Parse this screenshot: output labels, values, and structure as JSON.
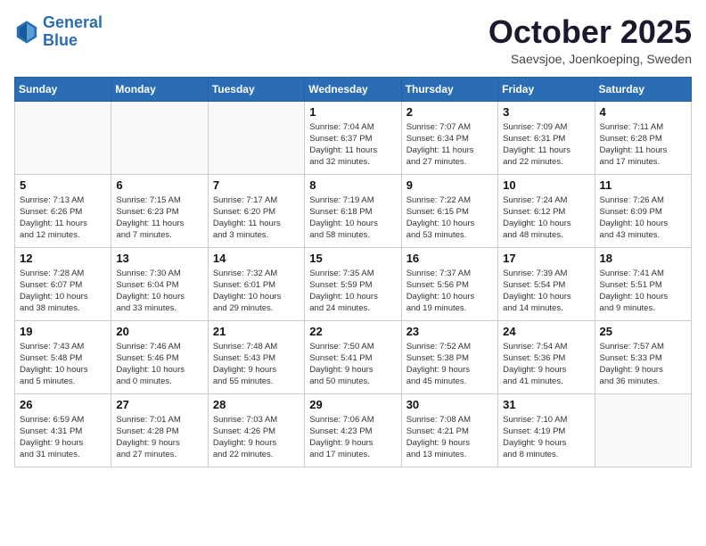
{
  "logo": {
    "line1": "General",
    "line2": "Blue"
  },
  "title": "October 2025",
  "location": "Saevsjoe, Joenkoeping, Sweden",
  "weekdays": [
    "Sunday",
    "Monday",
    "Tuesday",
    "Wednesday",
    "Thursday",
    "Friday",
    "Saturday"
  ],
  "weeks": [
    [
      {
        "day": "",
        "info": ""
      },
      {
        "day": "",
        "info": ""
      },
      {
        "day": "",
        "info": ""
      },
      {
        "day": "1",
        "info": "Sunrise: 7:04 AM\nSunset: 6:37 PM\nDaylight: 11 hours\nand 32 minutes."
      },
      {
        "day": "2",
        "info": "Sunrise: 7:07 AM\nSunset: 6:34 PM\nDaylight: 11 hours\nand 27 minutes."
      },
      {
        "day": "3",
        "info": "Sunrise: 7:09 AM\nSunset: 6:31 PM\nDaylight: 11 hours\nand 22 minutes."
      },
      {
        "day": "4",
        "info": "Sunrise: 7:11 AM\nSunset: 6:28 PM\nDaylight: 11 hours\nand 17 minutes."
      }
    ],
    [
      {
        "day": "5",
        "info": "Sunrise: 7:13 AM\nSunset: 6:26 PM\nDaylight: 11 hours\nand 12 minutes."
      },
      {
        "day": "6",
        "info": "Sunrise: 7:15 AM\nSunset: 6:23 PM\nDaylight: 11 hours\nand 7 minutes."
      },
      {
        "day": "7",
        "info": "Sunrise: 7:17 AM\nSunset: 6:20 PM\nDaylight: 11 hours\nand 3 minutes."
      },
      {
        "day": "8",
        "info": "Sunrise: 7:19 AM\nSunset: 6:18 PM\nDaylight: 10 hours\nand 58 minutes."
      },
      {
        "day": "9",
        "info": "Sunrise: 7:22 AM\nSunset: 6:15 PM\nDaylight: 10 hours\nand 53 minutes."
      },
      {
        "day": "10",
        "info": "Sunrise: 7:24 AM\nSunset: 6:12 PM\nDaylight: 10 hours\nand 48 minutes."
      },
      {
        "day": "11",
        "info": "Sunrise: 7:26 AM\nSunset: 6:09 PM\nDaylight: 10 hours\nand 43 minutes."
      }
    ],
    [
      {
        "day": "12",
        "info": "Sunrise: 7:28 AM\nSunset: 6:07 PM\nDaylight: 10 hours\nand 38 minutes."
      },
      {
        "day": "13",
        "info": "Sunrise: 7:30 AM\nSunset: 6:04 PM\nDaylight: 10 hours\nand 33 minutes."
      },
      {
        "day": "14",
        "info": "Sunrise: 7:32 AM\nSunset: 6:01 PM\nDaylight: 10 hours\nand 29 minutes."
      },
      {
        "day": "15",
        "info": "Sunrise: 7:35 AM\nSunset: 5:59 PM\nDaylight: 10 hours\nand 24 minutes."
      },
      {
        "day": "16",
        "info": "Sunrise: 7:37 AM\nSunset: 5:56 PM\nDaylight: 10 hours\nand 19 minutes."
      },
      {
        "day": "17",
        "info": "Sunrise: 7:39 AM\nSunset: 5:54 PM\nDaylight: 10 hours\nand 14 minutes."
      },
      {
        "day": "18",
        "info": "Sunrise: 7:41 AM\nSunset: 5:51 PM\nDaylight: 10 hours\nand 9 minutes."
      }
    ],
    [
      {
        "day": "19",
        "info": "Sunrise: 7:43 AM\nSunset: 5:48 PM\nDaylight: 10 hours\nand 5 minutes."
      },
      {
        "day": "20",
        "info": "Sunrise: 7:46 AM\nSunset: 5:46 PM\nDaylight: 10 hours\nand 0 minutes."
      },
      {
        "day": "21",
        "info": "Sunrise: 7:48 AM\nSunset: 5:43 PM\nDaylight: 9 hours\nand 55 minutes."
      },
      {
        "day": "22",
        "info": "Sunrise: 7:50 AM\nSunset: 5:41 PM\nDaylight: 9 hours\nand 50 minutes."
      },
      {
        "day": "23",
        "info": "Sunrise: 7:52 AM\nSunset: 5:38 PM\nDaylight: 9 hours\nand 45 minutes."
      },
      {
        "day": "24",
        "info": "Sunrise: 7:54 AM\nSunset: 5:36 PM\nDaylight: 9 hours\nand 41 minutes."
      },
      {
        "day": "25",
        "info": "Sunrise: 7:57 AM\nSunset: 5:33 PM\nDaylight: 9 hours\nand 36 minutes."
      }
    ],
    [
      {
        "day": "26",
        "info": "Sunrise: 6:59 AM\nSunset: 4:31 PM\nDaylight: 9 hours\nand 31 minutes."
      },
      {
        "day": "27",
        "info": "Sunrise: 7:01 AM\nSunset: 4:28 PM\nDaylight: 9 hours\nand 27 minutes."
      },
      {
        "day": "28",
        "info": "Sunrise: 7:03 AM\nSunset: 4:26 PM\nDaylight: 9 hours\nand 22 minutes."
      },
      {
        "day": "29",
        "info": "Sunrise: 7:06 AM\nSunset: 4:23 PM\nDaylight: 9 hours\nand 17 minutes."
      },
      {
        "day": "30",
        "info": "Sunrise: 7:08 AM\nSunset: 4:21 PM\nDaylight: 9 hours\nand 13 minutes."
      },
      {
        "day": "31",
        "info": "Sunrise: 7:10 AM\nSunset: 4:19 PM\nDaylight: 9 hours\nand 8 minutes."
      },
      {
        "day": "",
        "info": ""
      }
    ]
  ]
}
